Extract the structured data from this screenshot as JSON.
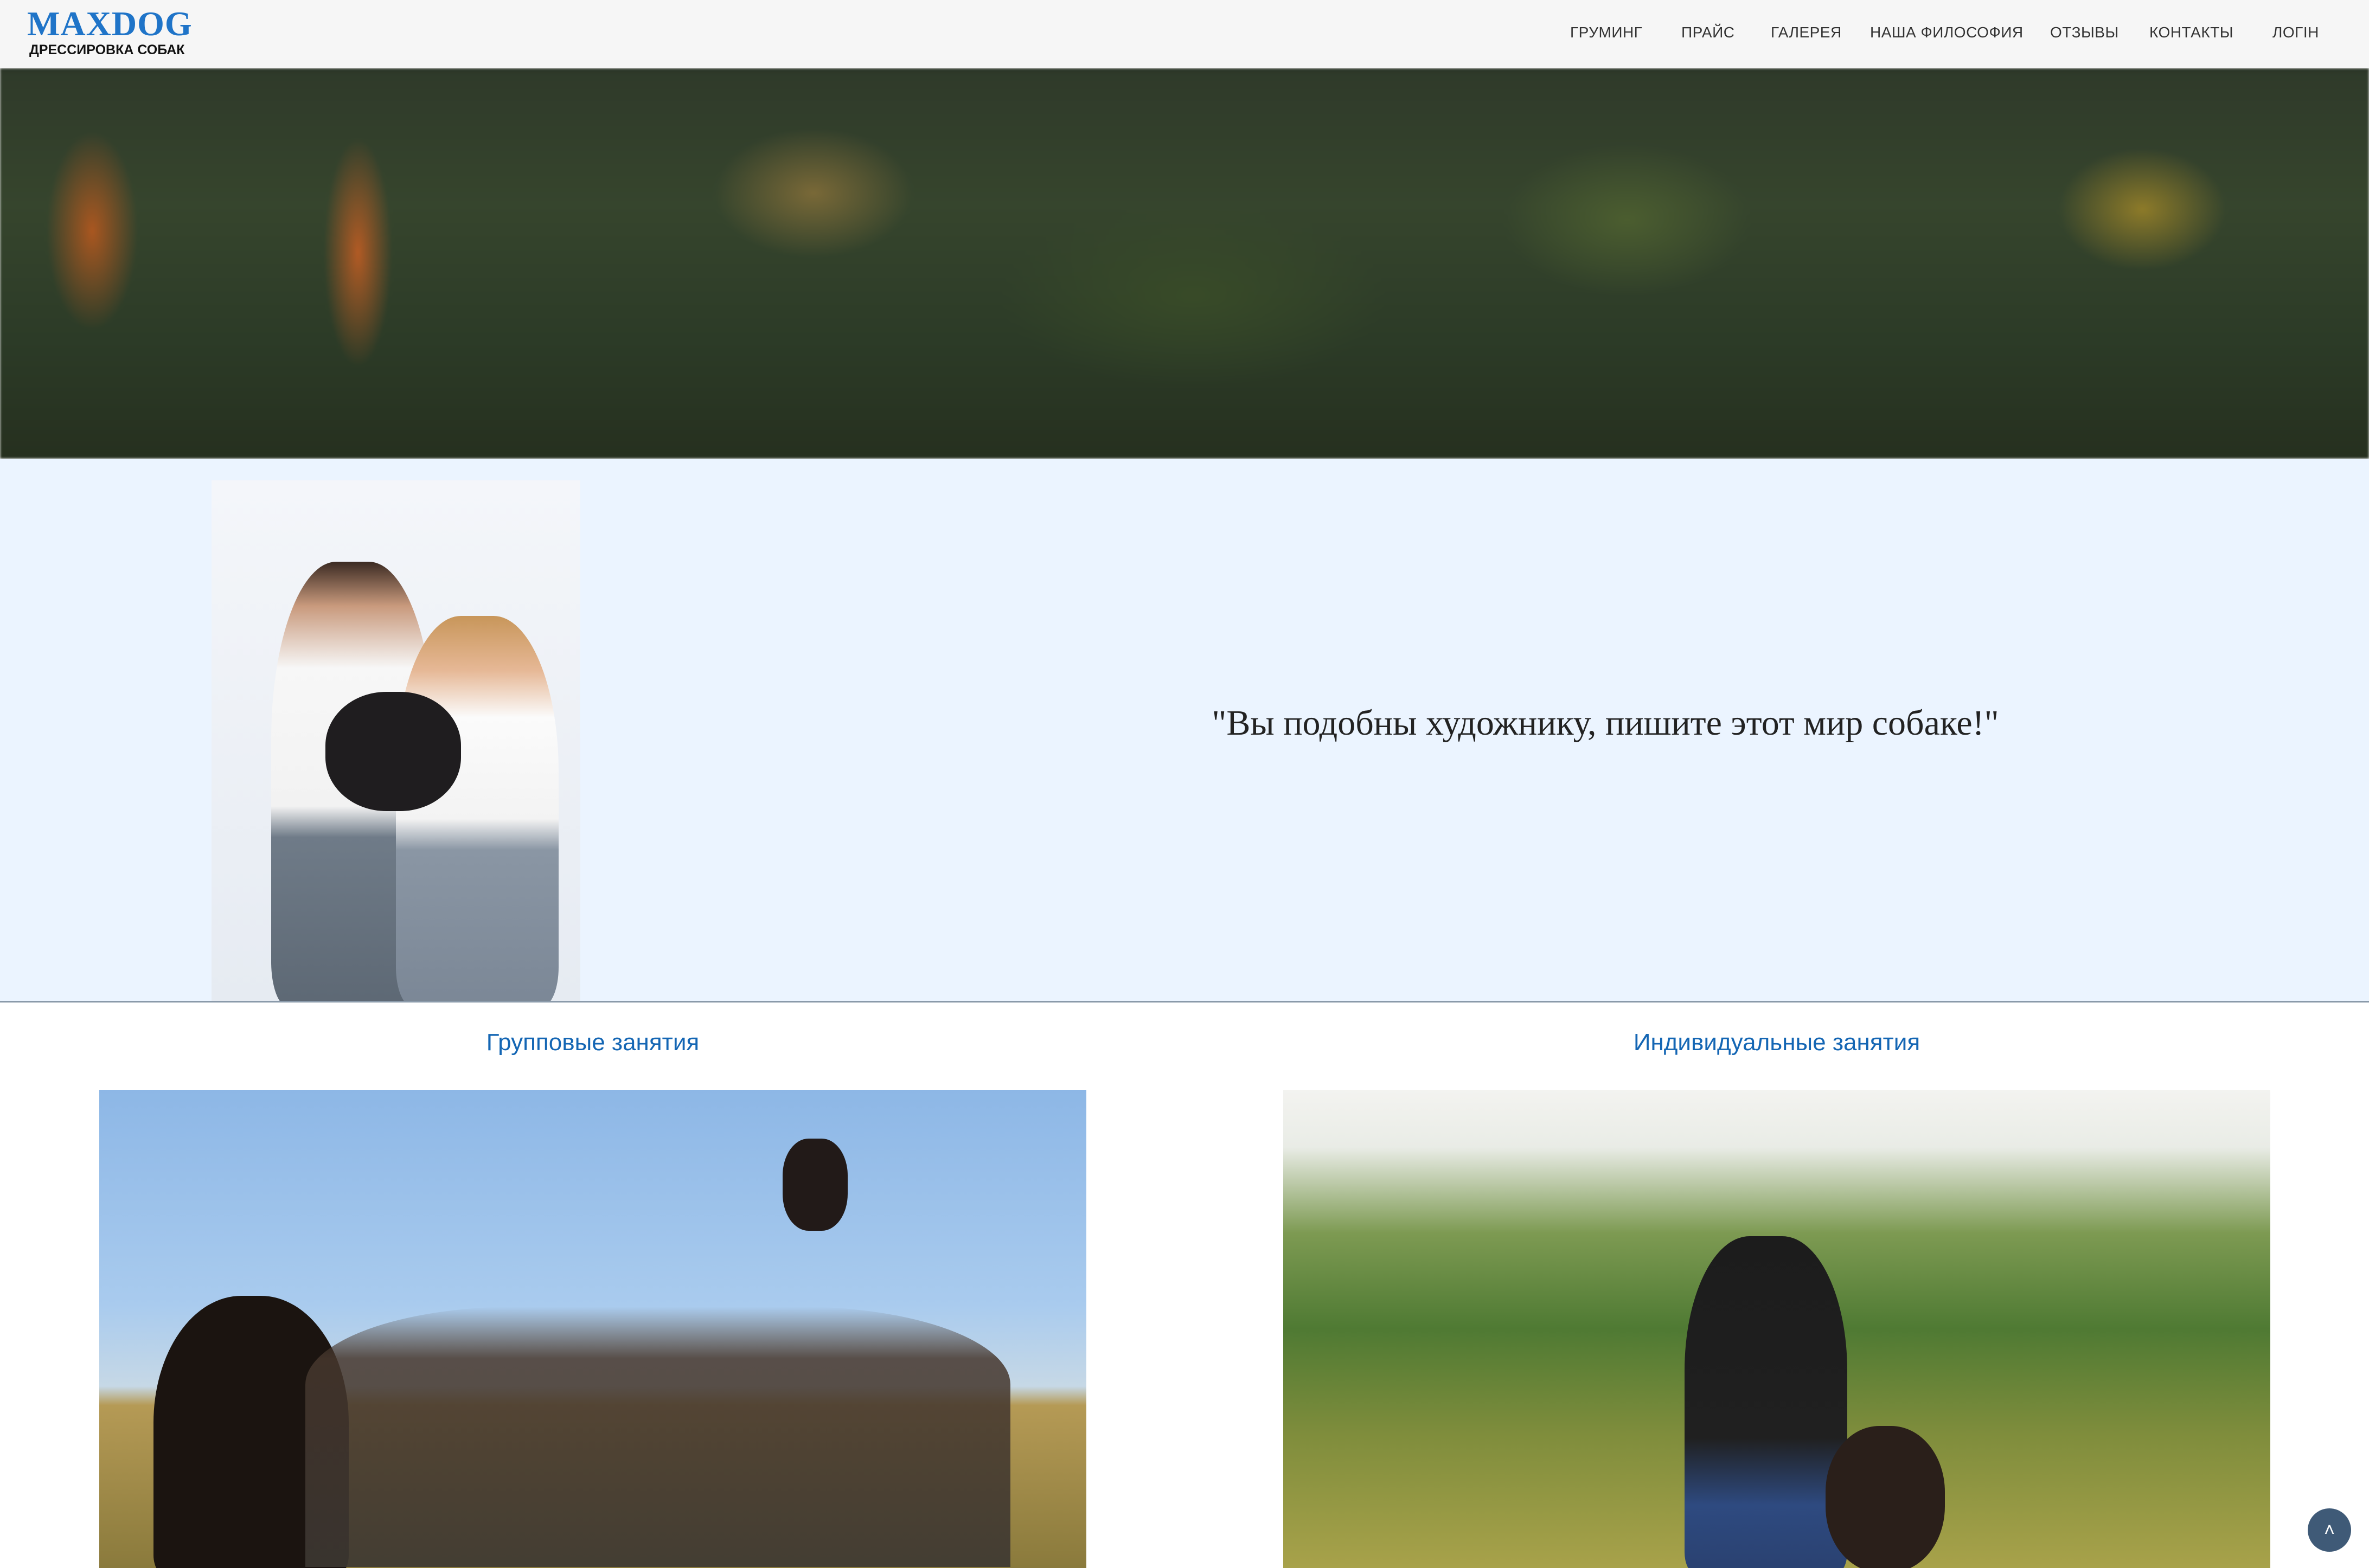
{
  "header": {
    "logo_title": "MAXDOG",
    "logo_subtitle": "ДРЕССИРОВКА СОБАК",
    "nav": [
      {
        "label": "ГРУМИНГ"
      },
      {
        "label": "ПРАЙС"
      },
      {
        "label": "ГАЛЕРЕЯ"
      },
      {
        "label": "НАША ФИЛОСОФИЯ"
      },
      {
        "label": "ОТЗЫВЫ"
      },
      {
        "label": "КОНТАКТЫ"
      },
      {
        "label": "ЛОГІН"
      }
    ]
  },
  "quote": {
    "text": "\"Вы подобны художнику, пишите этот мир собаке!\""
  },
  "sections": {
    "group": {
      "title": "Групповые занятия"
    },
    "individual": {
      "title": "Индивидуальные занятия"
    }
  },
  "colors": {
    "brand": "#1f74c8",
    "section_title": "#1466b4",
    "quote_background": "#ebf4ff",
    "scroll_button": "#3f5a77"
  },
  "icons": {
    "scroll_top": "chevron-up-icon"
  }
}
